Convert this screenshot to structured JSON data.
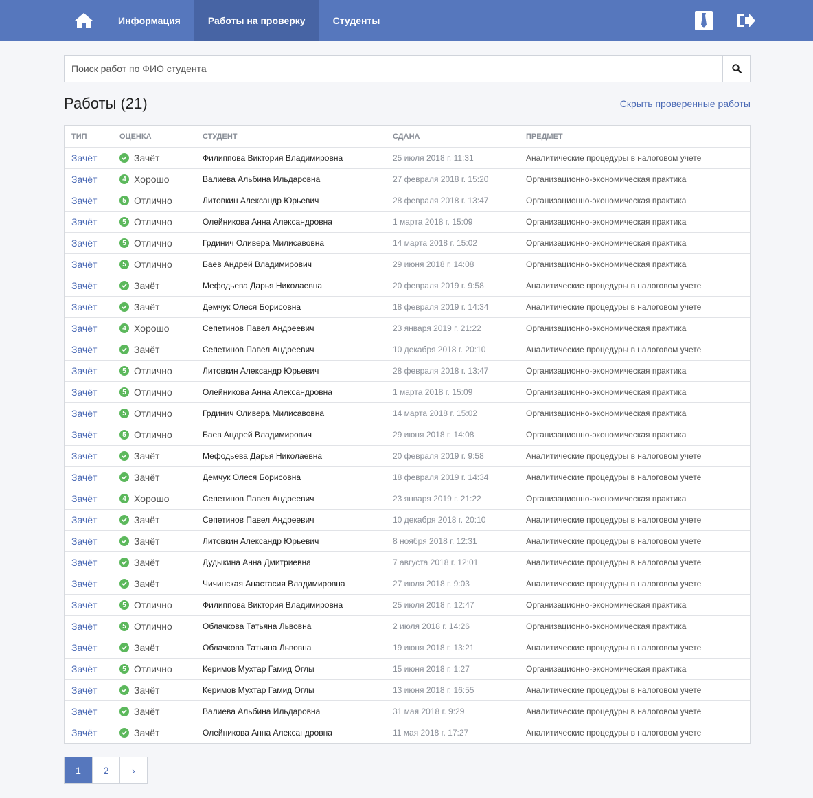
{
  "nav": {
    "links": [
      {
        "label": "Информация",
        "active": false
      },
      {
        "label": "Работы на проверку",
        "active": true
      },
      {
        "label": "Студенты",
        "active": false
      }
    ],
    "home_icon": "home-icon",
    "right_icons": [
      "tie-icon",
      "logout-icon"
    ]
  },
  "search": {
    "placeholder": "Поиск работ по ФИО студента",
    "value": "",
    "button_icon": "search-icon"
  },
  "title": "Работы (21)",
  "hide_link": "Скрыть проверенные работы",
  "table": {
    "headers": {
      "type": "Тип",
      "grade": "Оценка",
      "student": "Студент",
      "date": "Сдана",
      "subject": "Предмет"
    },
    "rows": [
      {
        "type": "Зачёт",
        "grade_icon": "check",
        "grade": "Зачёт",
        "student": "Филиппова Виктория Владимировна",
        "date": "25 июля 2018 г. 11:31",
        "subject": "Аналитические процедуры в налоговом учете"
      },
      {
        "type": "Зачёт",
        "grade_icon": "4",
        "grade": "Хорошо",
        "student": "Валиева Альбина Ильдаровна",
        "date": "27 февраля 2018 г. 15:20",
        "subject": "Организационно-экономическая практика"
      },
      {
        "type": "Зачёт",
        "grade_icon": "5",
        "grade": "Отлично",
        "student": "Литовкин Александр Юрьевич",
        "date": "28 февраля 2018 г. 13:47",
        "subject": "Организационно-экономическая практика"
      },
      {
        "type": "Зачёт",
        "grade_icon": "5",
        "grade": "Отлично",
        "student": "Олейникова Анна Александровна",
        "date": "1 марта 2018 г. 15:09",
        "subject": "Организационно-экономическая практика"
      },
      {
        "type": "Зачёт",
        "grade_icon": "5",
        "grade": "Отлично",
        "student": "Грдинич Оливера Милисавовна",
        "date": "14 марта 2018 г. 15:02",
        "subject": "Организационно-экономическая практика"
      },
      {
        "type": "Зачёт",
        "grade_icon": "5",
        "grade": "Отлично",
        "student": "Баев Андрей Владимирович",
        "date": "29 июня 2018 г. 14:08",
        "subject": "Организационно-экономическая практика"
      },
      {
        "type": "Зачёт",
        "grade_icon": "check",
        "grade": "Зачёт",
        "student": "Мефодьева Дарья Николаевна",
        "date": "20 февраля 2019 г. 9:58",
        "subject": "Аналитические процедуры в налоговом учете"
      },
      {
        "type": "Зачёт",
        "grade_icon": "check",
        "grade": "Зачёт",
        "student": "Демчук Олеся Борисовна",
        "date": "18 февраля 2019 г. 14:34",
        "subject": "Аналитические процедуры в налоговом учете"
      },
      {
        "type": "Зачёт",
        "grade_icon": "4",
        "grade": "Хорошо",
        "student": "Сепетинов Павел Андреевич",
        "date": "23 января 2019 г. 21:22",
        "subject": "Организационно-экономическая практика"
      },
      {
        "type": "Зачёт",
        "grade_icon": "check",
        "grade": "Зачёт",
        "student": "Сепетинов Павел Андреевич",
        "date": "10 декабря 2018 г. 20:10",
        "subject": "Аналитические процедуры в налоговом учете"
      },
      {
        "type": "Зачёт",
        "grade_icon": "5",
        "grade": "Отлично",
        "student": "Литовкин Александр Юрьевич",
        "date": "28 февраля 2018 г. 13:47",
        "subject": "Организационно-экономическая практика"
      },
      {
        "type": "Зачёт",
        "grade_icon": "5",
        "grade": "Отлично",
        "student": "Олейникова Анна Александровна",
        "date": "1 марта 2018 г. 15:09",
        "subject": "Организационно-экономическая практика"
      },
      {
        "type": "Зачёт",
        "grade_icon": "5",
        "grade": "Отлично",
        "student": "Грдинич Оливера Милисавовна",
        "date": "14 марта 2018 г. 15:02",
        "subject": "Организационно-экономическая практика"
      },
      {
        "type": "Зачёт",
        "grade_icon": "5",
        "grade": "Отлично",
        "student": "Баев Андрей Владимирович",
        "date": "29 июня 2018 г. 14:08",
        "subject": "Организационно-экономическая практика"
      },
      {
        "type": "Зачёт",
        "grade_icon": "check",
        "grade": "Зачёт",
        "student": "Мефодьева Дарья Николаевна",
        "date": "20 февраля 2019 г. 9:58",
        "subject": "Аналитические процедуры в налоговом учете"
      },
      {
        "type": "Зачёт",
        "grade_icon": "check",
        "grade": "Зачёт",
        "student": "Демчук Олеся Борисовна",
        "date": "18 февраля 2019 г. 14:34",
        "subject": "Аналитические процедуры в налоговом учете"
      },
      {
        "type": "Зачёт",
        "grade_icon": "4",
        "grade": "Хорошо",
        "student": "Сепетинов Павел Андреевич",
        "date": "23 января 2019 г. 21:22",
        "subject": "Организационно-экономическая практика"
      },
      {
        "type": "Зачёт",
        "grade_icon": "check",
        "grade": "Зачёт",
        "student": "Сепетинов Павел Андреевич",
        "date": "10 декабря 2018 г. 20:10",
        "subject": "Аналитические процедуры в налоговом учете"
      },
      {
        "type": "Зачёт",
        "grade_icon": "check",
        "grade": "Зачёт",
        "student": "Литовкин Александр Юрьевич",
        "date": "8 ноября 2018 г. 12:31",
        "subject": "Аналитические процедуры в налоговом учете"
      },
      {
        "type": "Зачёт",
        "grade_icon": "check",
        "grade": "Зачёт",
        "student": "Дудыкина Анна Дмитриевна",
        "date": "7 августа 2018 г. 12:01",
        "subject": "Аналитические процедуры в налоговом учете"
      },
      {
        "type": "Зачёт",
        "grade_icon": "check",
        "grade": "Зачёт",
        "student": "Чичинская Анастасия Владимировна",
        "date": "27 июля 2018 г. 9:03",
        "subject": "Аналитические процедуры в налоговом учете"
      },
      {
        "type": "Зачёт",
        "grade_icon": "5",
        "grade": "Отлично",
        "student": "Филиппова Виктория Владимировна",
        "date": "25 июля 2018 г. 12:47",
        "subject": "Организационно-экономическая практика"
      },
      {
        "type": "Зачёт",
        "grade_icon": "5",
        "grade": "Отлично",
        "student": "Облачкова Татьяна Львовна",
        "date": "2 июля 2018 г. 14:26",
        "subject": "Организационно-экономическая практика"
      },
      {
        "type": "Зачёт",
        "grade_icon": "check",
        "grade": "Зачёт",
        "student": "Облачкова Татьяна Львовна",
        "date": "19 июня 2018 г. 13:21",
        "subject": "Аналитические процедуры в налоговом учете"
      },
      {
        "type": "Зачёт",
        "grade_icon": "5",
        "grade": "Отлично",
        "student": "Керимов Мухтар Гамид Оглы",
        "date": "15 июня 2018 г. 1:27",
        "subject": "Организационно-экономическая практика"
      },
      {
        "type": "Зачёт",
        "grade_icon": "check",
        "grade": "Зачёт",
        "student": "Керимов Мухтар Гамид Оглы",
        "date": "13 июня 2018 г. 16:55",
        "subject": "Аналитические процедуры в налоговом учете"
      },
      {
        "type": "Зачёт",
        "grade_icon": "check",
        "grade": "Зачёт",
        "student": "Валиева Альбина Ильдаровна",
        "date": "31 мая 2018 г. 9:29",
        "subject": "Аналитические процедуры в налоговом учете"
      },
      {
        "type": "Зачёт",
        "grade_icon": "check",
        "grade": "Зачёт",
        "student": "Олейникова Анна Александровна",
        "date": "11 мая 2018 г. 17:27",
        "subject": "Аналитические процедуры в налоговом учете"
      }
    ]
  },
  "pagination": {
    "pages": [
      "1",
      "2"
    ],
    "current": "1",
    "next": "›"
  },
  "colors": {
    "navbar": "#5677bd",
    "nav_active": "#4764a4",
    "link": "#4b6ab5",
    "grade_badge": "#5cb85c"
  }
}
